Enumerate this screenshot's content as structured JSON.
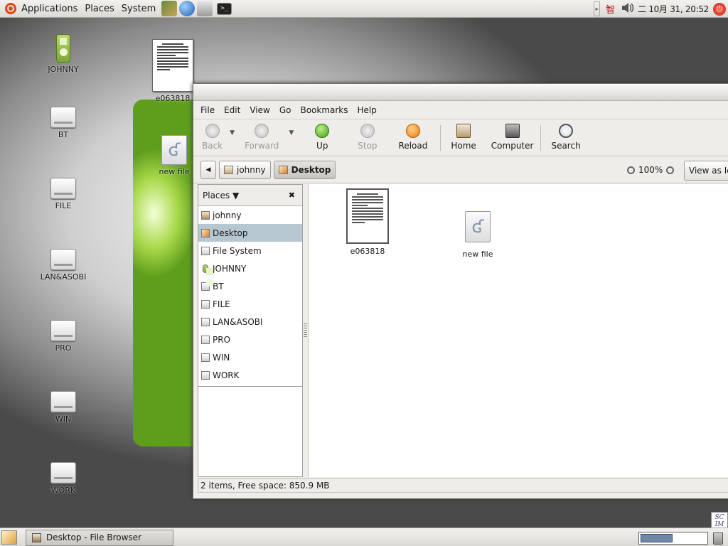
{
  "top_panel": {
    "menus": [
      "Applications",
      "Places",
      "System"
    ],
    "launchers": [
      "books-icon",
      "globe-icon",
      "tool-icon",
      "terminal-icon"
    ],
    "tray": {
      "ime": "智",
      "clock": "二 10月 31, 20:52"
    }
  },
  "desktop": {
    "icons": [
      {
        "label": "JOHNNY",
        "kind": "ipod"
      },
      {
        "label": "BT",
        "kind": "drive"
      },
      {
        "label": "FILE",
        "kind": "drive"
      },
      {
        "label": "LAN&ASOBI",
        "kind": "drive"
      },
      {
        "label": "PRO",
        "kind": "drive"
      },
      {
        "label": "WIN",
        "kind": "drive"
      },
      {
        "label": "WORK",
        "kind": "drive"
      }
    ],
    "file_icons": [
      {
        "label": "e063818",
        "kind": "document"
      },
      {
        "label": "new file",
        "kind": "gnome-file"
      }
    ]
  },
  "window": {
    "menubar": [
      "File",
      "Edit",
      "View",
      "Go",
      "Bookmarks",
      "Help"
    ],
    "toolbar": {
      "back": "Back",
      "forward": "Forward",
      "up": "Up",
      "stop": "Stop",
      "reload": "Reload",
      "home": "Home",
      "computer": "Computer",
      "search": "Search"
    },
    "location": {
      "crumbs": [
        "johnny",
        "Desktop"
      ],
      "zoom": "100%",
      "view_as": "View as Icons"
    },
    "sidebar": {
      "header": "Places",
      "items": [
        {
          "label": "johnny",
          "icon": "home-icon"
        },
        {
          "label": "Desktop",
          "icon": "desktop-icon",
          "selected": true
        },
        {
          "label": "File System",
          "icon": "drive-icon"
        },
        {
          "label": "JOHNNY",
          "icon": "ipod-icon"
        },
        {
          "label": "BT",
          "icon": "drive-icon"
        },
        {
          "label": "FILE",
          "icon": "drive-icon"
        },
        {
          "label": "LAN&ASOBI",
          "icon": "drive-icon"
        },
        {
          "label": "PRO",
          "icon": "drive-icon"
        },
        {
          "label": "WIN",
          "icon": "drive-icon"
        },
        {
          "label": "WORK",
          "icon": "drive-icon"
        }
      ]
    },
    "files": [
      {
        "label": "e063818",
        "kind": "document"
      },
      {
        "label": "new file",
        "kind": "gnome-file"
      }
    ],
    "status": "2 items, Free space: 850.9 MB"
  },
  "bottom_panel": {
    "task": "Desktop - File Browser",
    "scim": "SC IM"
  },
  "colors": {
    "accent_selection": "#b7c7d2",
    "panel": "#dcdad5"
  }
}
